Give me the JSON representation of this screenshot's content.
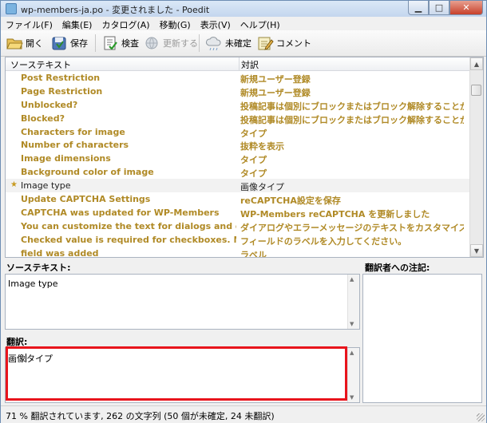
{
  "window": {
    "title": "wp-members-ja.po - 変更されました - Poedit"
  },
  "menu": [
    "ファイル(F)",
    "編集(E)",
    "カタログ(A)",
    "移動(G)",
    "表示(V)",
    "ヘルプ(H)"
  ],
  "toolbar": {
    "open": "開く",
    "save": "保存",
    "validate": "検査",
    "update": "更新する",
    "fuzzy": "未確定",
    "comment": "コメント"
  },
  "list": {
    "col_source": "ソーステキスト",
    "col_translation": "対訳",
    "rows": [
      {
        "source": "Post Restriction",
        "translation": "新規ユーザー登録"
      },
      {
        "source": "Page Restriction",
        "translation": "新規ユーザー登録"
      },
      {
        "source": "Unblocked?",
        "translation": "投稿記事は個別にブロックまたはブロック解除することができま..."
      },
      {
        "source": "Blocked?",
        "translation": "投稿記事は個別にブロックまたはブロック解除することができま..."
      },
      {
        "source": "Characters for image",
        "translation": "タイプ"
      },
      {
        "source": "Number of characters",
        "translation": "抜粋を表示"
      },
      {
        "source": "Image dimensions",
        "translation": "タイプ"
      },
      {
        "source": "Background color of image",
        "translation": "タイプ"
      },
      {
        "source": "Image type",
        "translation": "画像タイプ",
        "selected": true,
        "marker": "★"
      },
      {
        "source": "Update CAPTCHA Settings",
        "translation": "reCAPTCHA設定を保存"
      },
      {
        "source": "CAPTCHA was updated for WP-Members",
        "translation": "WP-Members reCAPTCHA を更新しました"
      },
      {
        "source": "You can customize the text for dialogs and error me...",
        "translation": "ダイアログやエラーメッセージのテキストをカスタマイズするこ..."
      },
      {
        "source": "Checked value is required for checkboxes. Nothing w...",
        "translation": "フィールドのラベルを入力してください。"
      },
      {
        "source": "field was added",
        "translation": "ラベル"
      }
    ]
  },
  "editor": {
    "source_label": "ソーステキスト:",
    "source_text": "Image type",
    "notes_label": "翻訳者への注記:",
    "translation_label": "翻訳:",
    "translation_before_cursor": "画像",
    "translation_after_cursor": "タイプ",
    "highlight_color": "#e8141c"
  },
  "status": "71 % 翻訳されています, 262 の文字列 (50 個が未確定, 24 未翻訳)"
}
